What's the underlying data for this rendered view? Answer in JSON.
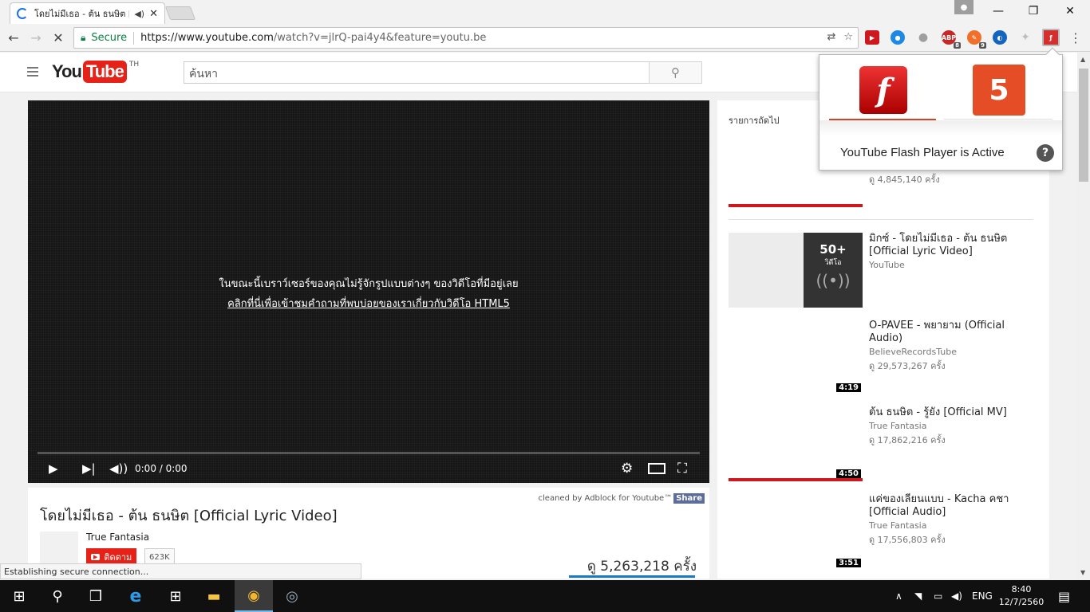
{
  "browser": {
    "tab_title": "โดยไม่มีเธอ - ต้น ธนษิต [",
    "tab_close": "✕",
    "secure_label": "Secure",
    "url_host": "https://www.youtube.com",
    "url_path": "/watch?v=jlrQ-pai4y4&feature=youtu.be",
    "extensions": [
      {
        "name": "youtube-ext",
        "color": "#cc181e"
      },
      {
        "name": "search-ext",
        "color": "#1e88e5"
      },
      {
        "name": "drop-ext",
        "color": "#9e9e9e"
      },
      {
        "name": "adblock-plus",
        "label": "ABP",
        "badge": "8",
        "color": "#c62828"
      },
      {
        "name": "pen-ext",
        "badge": "9",
        "color": "#f06f2a"
      },
      {
        "name": "globe-ext",
        "color": "#1565c0"
      },
      {
        "name": "puzzle-ext",
        "color": "#bdbdbd"
      },
      {
        "name": "flash-ext",
        "color": "#d32f2f"
      }
    ]
  },
  "youtube": {
    "logo_you": "You",
    "logo_tube": "Tube",
    "logo_country": "TH",
    "search_placeholder": "ค้นหา"
  },
  "player": {
    "message_line1": "ในขณะนี้เบราว์เซอร์ของคุณไม่รู้จักรูปแบบต่างๆ ของวิดีโอที่มีอยู่เลย",
    "message_link": "คลิกที่นี่เพื่อเข้าชมคำถามที่พบบ่อยของเราเกี่ยวกับวิดีโอ HTML5",
    "time": "0:00 / 0:00"
  },
  "video_info": {
    "adblock_text": "cleaned by Adblock for Youtube™",
    "share_label": "Share",
    "title": "โดยไม่มีเธอ - ต้น ธนษิต [Official Lyric Video]",
    "channel": "True Fantasia",
    "subscribe_label": "ติดตาม",
    "subscriber_count": "623K",
    "views": "ดู 5,263,218 ครั้ง"
  },
  "sidebar": {
    "up_next": "รายการถัดไป",
    "first_views": "ดู 4,845,140 ครั้ง",
    "playlist": {
      "count": "50+",
      "label": "วิดีโอ",
      "title": "มิกซ์ - โดยไม่มีเธอ - ต้น ธนษิต [Official Lyric Video]",
      "channel": "YouTube"
    },
    "items": [
      {
        "title": "O-PAVEE - พยายาม (Official Audio)",
        "channel": "BelieveRecordsTube",
        "views": "ดู 29,573,267 ครั้ง",
        "duration": "4:19"
      },
      {
        "title": "ต้น ธนษิต - รู้ยัง [Official MV]",
        "channel": "True Fantasia",
        "views": "ดู 17,862,216 ครั้ง",
        "duration": "4:50"
      },
      {
        "title": "แค่ของเลียนแบบ - Kacha คชา [Official Audio]",
        "channel": "True Fantasia",
        "views": "ดู 17,556,803 ครั้ง",
        "duration": "3:51"
      }
    ]
  },
  "flash_popup": {
    "status": "YouTube Flash Player is Active",
    "flash_glyph": "f",
    "html5_glyph": "5",
    "help_glyph": "?"
  },
  "status_bar": "Establishing secure connection...",
  "taskbar": {
    "language": "ENG",
    "time": "8:40",
    "date": "12/7/2560"
  }
}
